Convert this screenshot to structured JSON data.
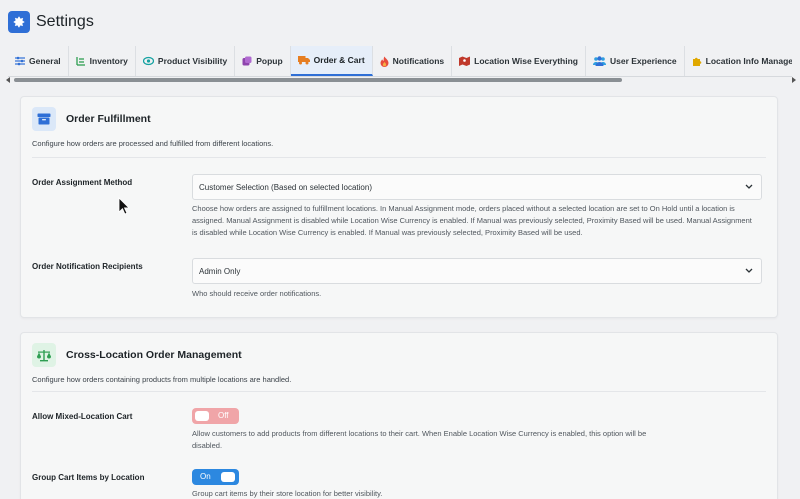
{
  "header": {
    "title": "Settings",
    "icon": "gear-icon"
  },
  "tabs": [
    {
      "label": "General",
      "icon": "sliders-icon",
      "color": "#2f6fd6"
    },
    {
      "label": "Inventory",
      "icon": "list-icon",
      "color": "#2e9e52"
    },
    {
      "label": "Product Visibility",
      "icon": "eye-icon",
      "color": "#17a2a2"
    },
    {
      "label": "Popup",
      "icon": "popup-icon",
      "color": "#8e44ad"
    },
    {
      "label": "Order & Cart",
      "icon": "truck-icon",
      "color": "#e67e22",
      "active": true
    },
    {
      "label": "Notifications",
      "icon": "flame-icon",
      "color": "#e74c3c"
    },
    {
      "label": "Location Wise Everything",
      "icon": "map-icon",
      "color": "#c0392b"
    },
    {
      "label": "User Experience",
      "icon": "users-icon",
      "color": "#2f6fd6"
    },
    {
      "label": "Location Info Management",
      "icon": "puzzle-icon",
      "color": "#e0a800"
    },
    {
      "label": "",
      "icon": "menu-icon",
      "color": "#2f6fd6"
    }
  ],
  "fulfillment": {
    "title": "Order Fulfillment",
    "description": "Configure how orders are processed and fulfilled from different locations.",
    "assignment": {
      "label": "Order Assignment Method",
      "value": "Customer Selection (Based on selected location)",
      "help": "Choose how orders are assigned to fulfillment locations. In Manual Assignment mode, orders placed without a selected location are set to On Hold until a location is assigned. Manual Assignment is disabled while Location Wise Currency is enabled. If Manual was previously selected, Proximity Based will be used. Manual Assignment is disabled while Location Wise Currency is enabled. If Manual was previously selected, Proximity Based will be used."
    },
    "recipients": {
      "label": "Order Notification Recipients",
      "value": "Admin Only",
      "help": "Who should receive order notifications."
    }
  },
  "cross_location": {
    "title": "Cross-Location Order Management",
    "description": "Configure how orders containing products from multiple locations are handled.",
    "mixed_cart": {
      "label": "Allow Mixed-Location Cart",
      "state": "Off",
      "help": "Allow customers to add products from different locations to their cart. When Enable Location Wise Currency is enabled, this option will be disabled."
    },
    "group_cart": {
      "label": "Group Cart Items by Location",
      "state": "On",
      "help": "Group cart items by their store location for better visibility."
    }
  }
}
